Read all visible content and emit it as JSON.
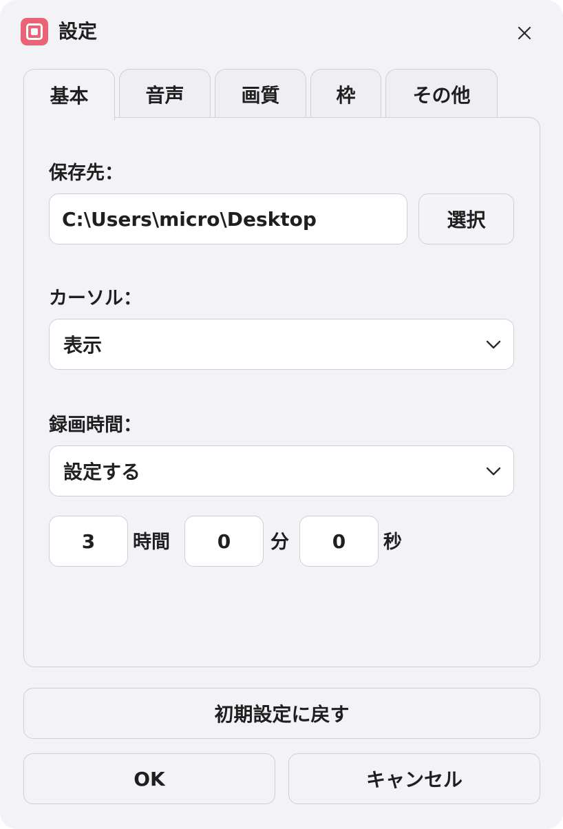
{
  "window": {
    "title": "設定",
    "accent_color": "#ea6477",
    "icon": "screen-capture-icon",
    "close_icon": "close-icon"
  },
  "tabs": [
    {
      "label": "基本",
      "active": true
    },
    {
      "label": "音声",
      "active": false
    },
    {
      "label": "画質",
      "active": false
    },
    {
      "label": "枠",
      "active": false
    },
    {
      "label": "その他",
      "active": false
    }
  ],
  "save_location": {
    "label": "保存先：",
    "value": "C:\\Users\\micro\\Desktop",
    "select_button": "選択"
  },
  "cursor": {
    "label": "カーソル：",
    "selected": "表示"
  },
  "recording_time": {
    "label": "録画時間：",
    "selected": "設定する",
    "hours": "3",
    "hours_unit": "時間",
    "minutes": "0",
    "minutes_unit": "分",
    "seconds": "0",
    "seconds_unit": "秒"
  },
  "buttons": {
    "reset": "初期設定に戻す",
    "ok": "OK",
    "cancel": "キャンセル"
  }
}
